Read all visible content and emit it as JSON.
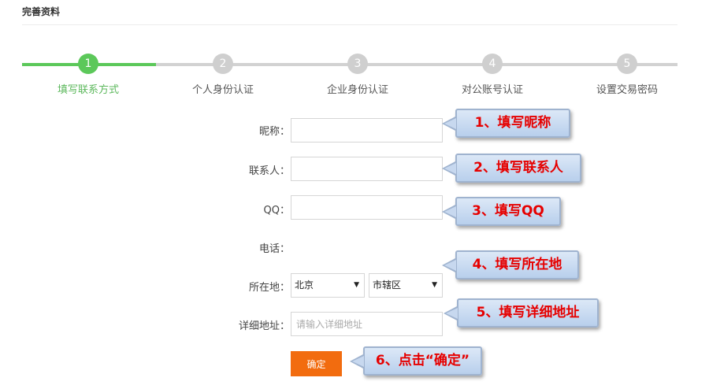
{
  "page": {
    "title": "完善资料"
  },
  "stepper": {
    "accent": "#5cc85a",
    "steps": [
      {
        "num": "1",
        "label": "填写联系方式",
        "state": "done"
      },
      {
        "num": "2",
        "label": "个人身份认证",
        "state": "todo"
      },
      {
        "num": "3",
        "label": "企业身份认证",
        "state": "todo"
      },
      {
        "num": "4",
        "label": "对公账号认证",
        "state": "todo"
      },
      {
        "num": "5",
        "label": "设置交易密码",
        "state": "todo"
      }
    ]
  },
  "form": {
    "nickname_label": "昵称：",
    "nickname_value": "",
    "contact_label": "联系人：",
    "contact_value": "",
    "qq_label": "QQ：",
    "qq_value": "",
    "phone_label": "电话：",
    "location_label": "所在地：",
    "province_selected": "北京",
    "district_selected": "市辖区",
    "address_label": "详细地址：",
    "address_placeholder": "请输入详细地址",
    "confirm_label": "确定",
    "confirm_color": "#f26c0f"
  },
  "callouts": [
    "1、填写昵称",
    "2、填写联系人",
    "3、填写QQ",
    "4、填写所在地",
    "5、填写详细地址",
    "6、点击“确定”"
  ]
}
